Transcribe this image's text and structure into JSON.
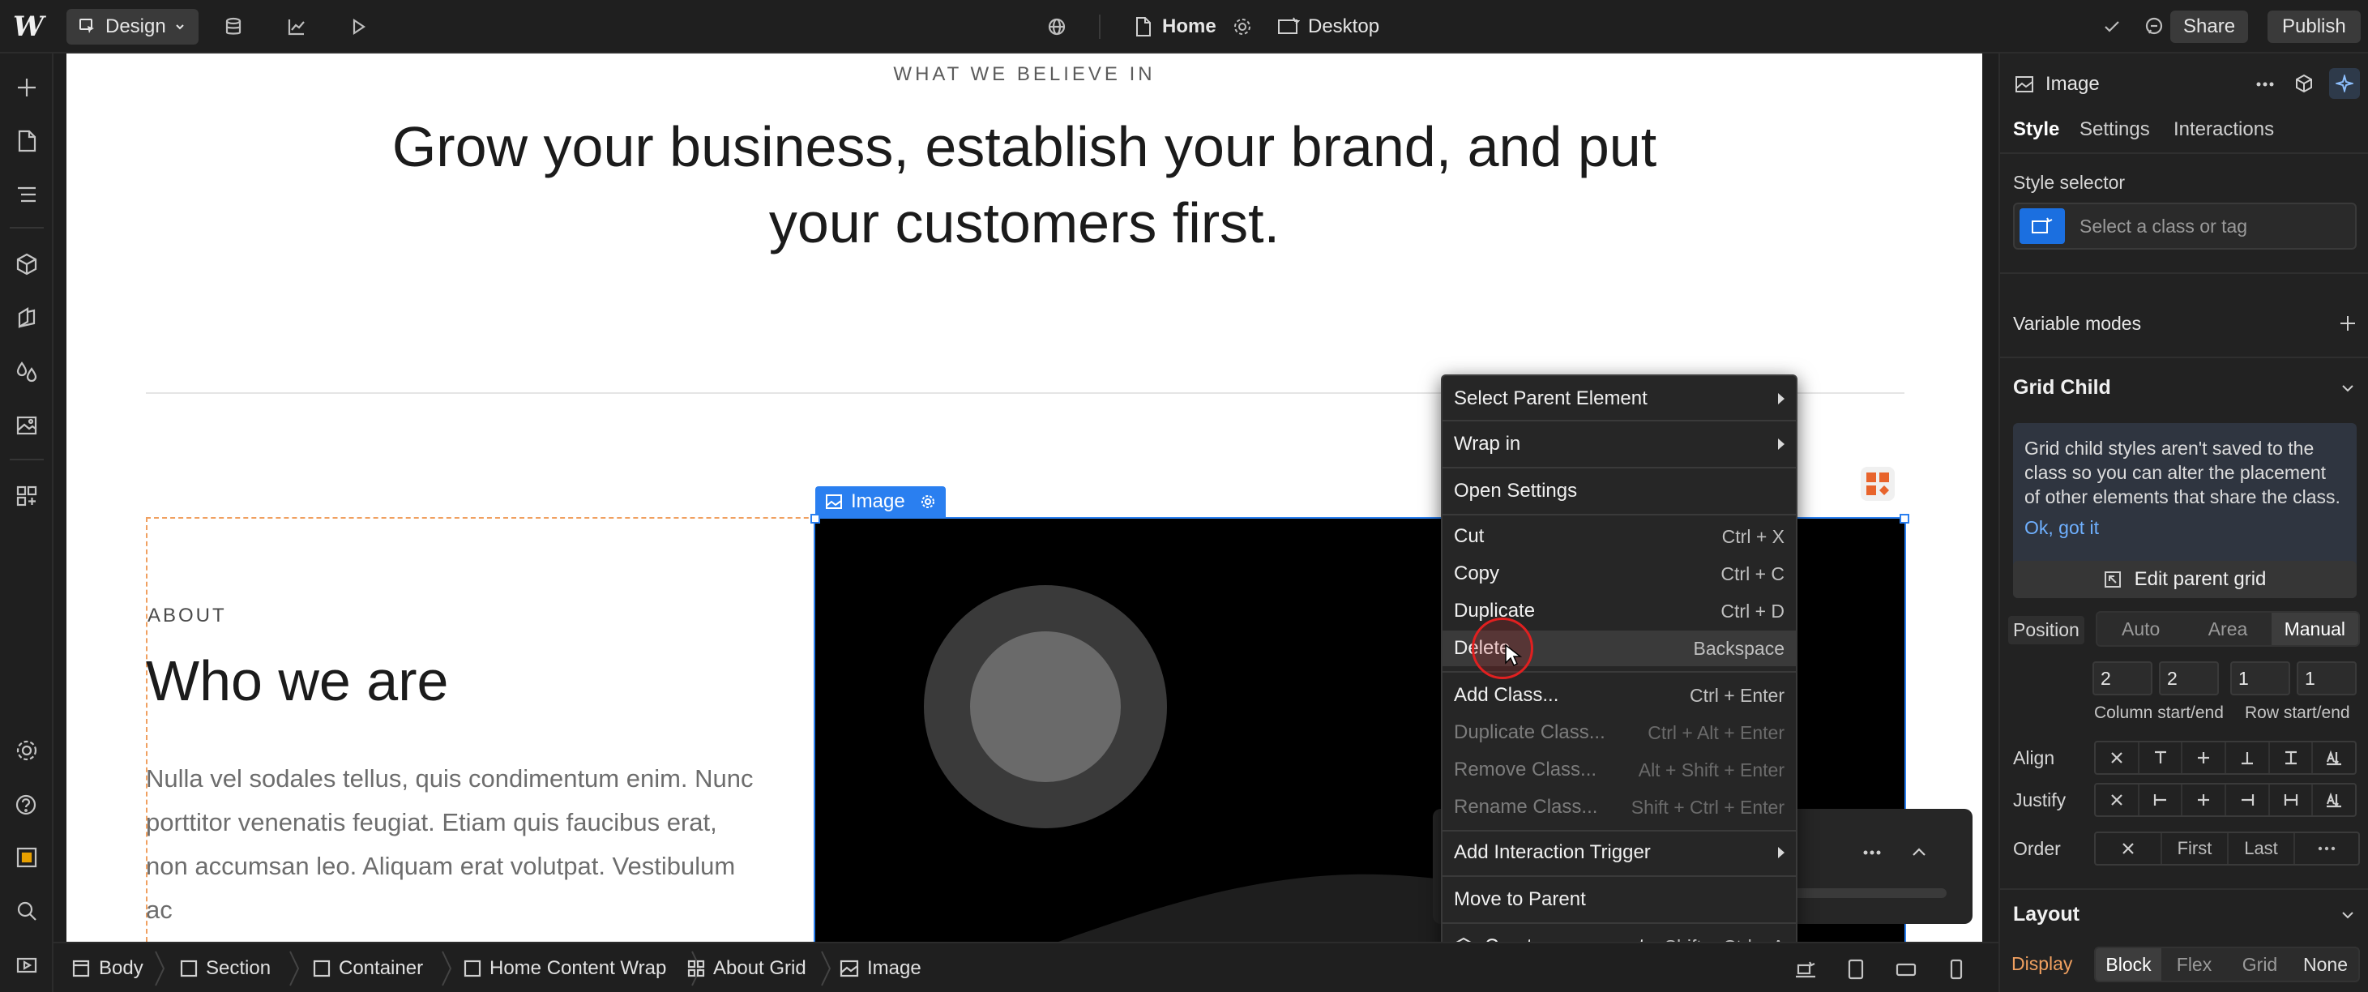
{
  "topbar": {
    "logo": "W",
    "mode_label": "Design",
    "page_label": "Home",
    "device_label": "Desktop",
    "share_label": "Share",
    "publish_label": "Publish"
  },
  "canvas": {
    "eyebrow": "WHAT WE BELIEVE IN",
    "headline_line1": "Grow your business, establish your brand, and put",
    "headline_line2": "your customers first.",
    "about_label": "ABOUT",
    "about_title": "Who we are",
    "about_body": "Nulla vel sodales tellus, quis condimentum enim. Nunc porttitor venenatis feugiat. Etiam quis faucibus erat, non accumsan leo. Aliquam erat volutpat. Vestibulum ac",
    "selected_tag": "Image"
  },
  "context_menu": {
    "items": [
      {
        "label": "Select Parent Element",
        "shortcut": ""
      },
      {
        "label": "Wrap in",
        "shortcut": ""
      },
      {
        "label": "Open Settings",
        "shortcut": ""
      },
      {
        "label": "Cut",
        "shortcut": "Ctrl + X"
      },
      {
        "label": "Copy",
        "shortcut": "Ctrl + C"
      },
      {
        "label": "Duplicate",
        "shortcut": "Ctrl + D"
      },
      {
        "label": "Delete",
        "shortcut": "Backspace"
      },
      {
        "label": "Add Class...",
        "shortcut": "Ctrl + Enter"
      },
      {
        "label": "Duplicate Class...",
        "shortcut": "Ctrl + Alt + Enter"
      },
      {
        "label": "Remove Class...",
        "shortcut": "Alt + Shift + Enter"
      },
      {
        "label": "Rename Class...",
        "shortcut": "Shift + Ctrl + Enter"
      },
      {
        "label": "Add Interaction Trigger",
        "shortcut": ""
      },
      {
        "label": "Move to Parent",
        "shortcut": ""
      },
      {
        "label": "Create component",
        "shortcut": "Shift + Ctrl + A"
      }
    ]
  },
  "right_panel": {
    "element_title": "Image",
    "tabs": [
      "Style",
      "Settings",
      "Interactions"
    ],
    "style_selector_label": "Style selector",
    "style_selector_placeholder": "Select a class or tag",
    "variable_modes_label": "Variable modes",
    "grid_child_label": "Grid Child",
    "grid_child_info": "Grid child styles aren't saved to the class so you can alter the placement of other elements that share the class.",
    "grid_child_link": "Ok, got it",
    "edit_parent_grid": "Edit parent grid",
    "position_label": "Position",
    "position_options": [
      "Auto",
      "Area",
      "Manual"
    ],
    "column_start": "2",
    "column_end": "2",
    "row_start": "1",
    "row_end": "1",
    "column_caption": "Column start/end",
    "row_caption": "Row start/end",
    "align_label": "Align",
    "justify_label": "Justify",
    "order_label": "Order",
    "order_first": "First",
    "order_last": "Last",
    "layout_label": "Layout",
    "display_label": "Display",
    "display_options": [
      "Block",
      "Flex",
      "Grid",
      "None"
    ]
  },
  "breadcrumbs": [
    "Body",
    "Section",
    "Container",
    "Home Content Wrap",
    "About Grid",
    "Image"
  ]
}
